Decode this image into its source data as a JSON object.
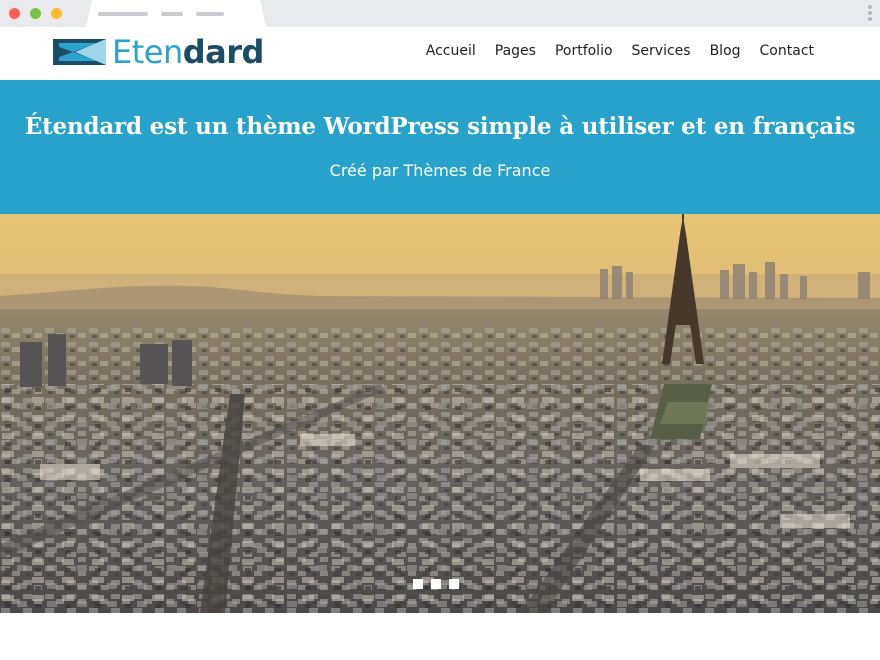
{
  "site": {
    "logo_text_light": "Eten",
    "logo_text_bold": "dard"
  },
  "nav": {
    "items": [
      "Accueil",
      "Pages",
      "Portfolio",
      "Services",
      "Blog",
      "Contact"
    ]
  },
  "hero": {
    "title": "Étendard est un thème WordPress simple à utiliser et en français",
    "subtitle": "Créé par Thèmes de France"
  },
  "slider": {
    "image": "aerial-view-of-paris-eiffel-tower",
    "dots_count": 3,
    "active_dot": 0
  },
  "colors": {
    "hero_bg": "#27a3cb",
    "logo_light": "#2ca3cc",
    "logo_dark": "#1d4d66"
  }
}
